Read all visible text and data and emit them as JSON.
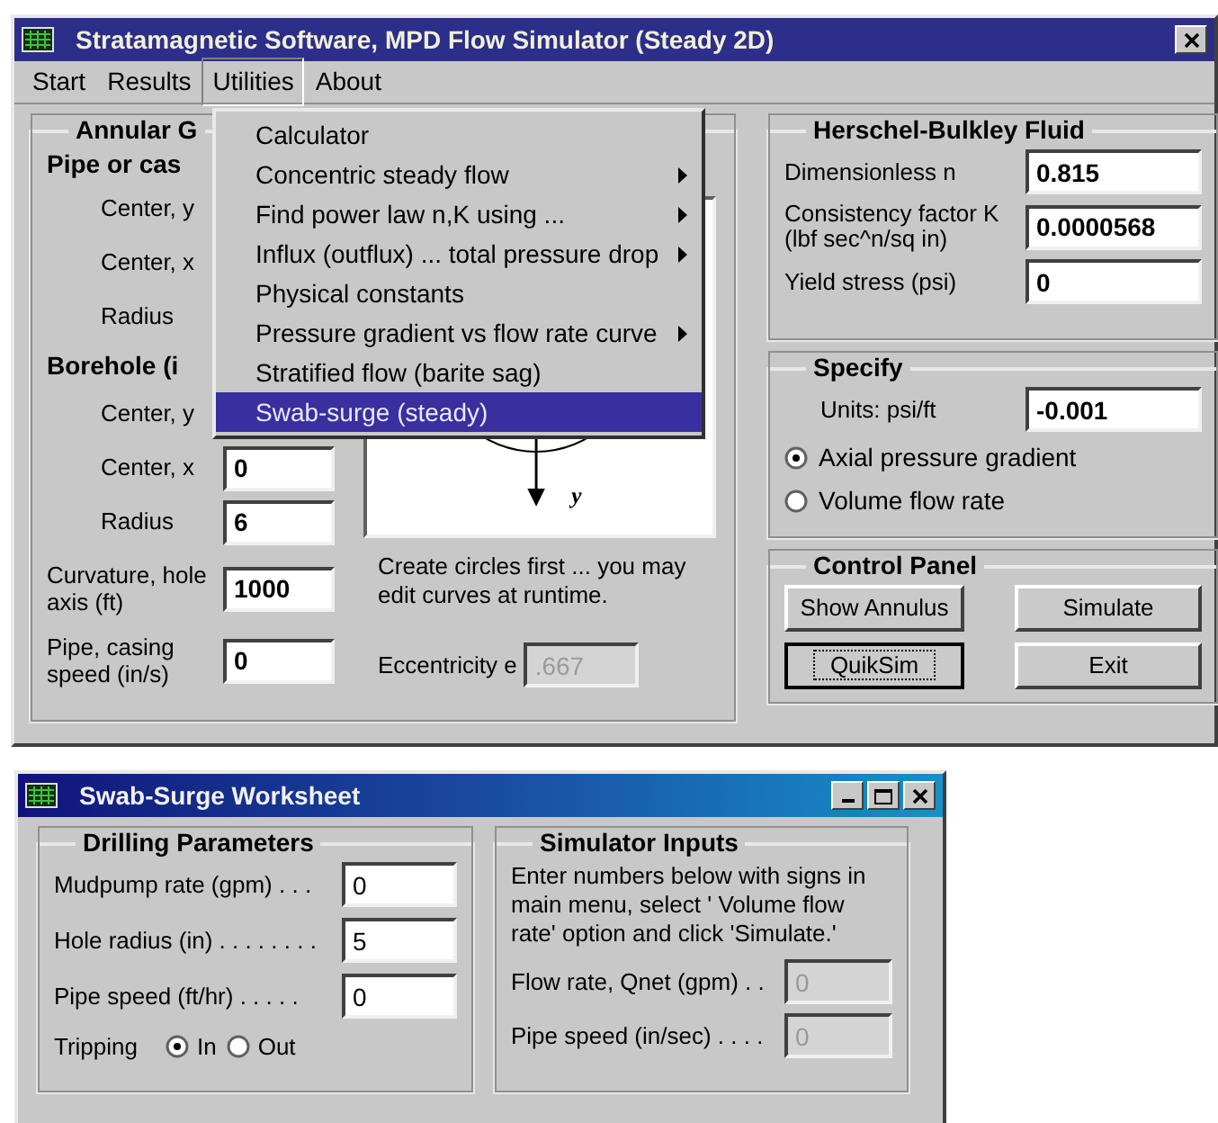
{
  "main_window": {
    "title": "Stratamagnetic Software, MPD Flow Simulator (Steady 2D)",
    "menu": [
      {
        "label": "Start",
        "selected": false
      },
      {
        "label": "Results",
        "selected": false
      },
      {
        "label": "Utilities",
        "selected": true
      },
      {
        "label": "About",
        "selected": false
      }
    ],
    "dropdown": [
      {
        "label": "Calculator",
        "submenu": false,
        "selected": false
      },
      {
        "label": "Concentric steady flow",
        "submenu": true,
        "selected": false
      },
      {
        "label": "Find power law n,K using ...",
        "submenu": true,
        "selected": false
      },
      {
        "label": "Influx (outflux) ... total pressure drop",
        "submenu": true,
        "selected": false
      },
      {
        "label": "Physical constants",
        "submenu": false,
        "selected": false
      },
      {
        "label": "Pressure gradient vs flow rate curve",
        "submenu": true,
        "selected": false
      },
      {
        "label": "Stratified flow (barite sag)",
        "submenu": false,
        "selected": false
      },
      {
        "label": "Swab-surge (steady)",
        "submenu": false,
        "selected": true
      }
    ],
    "annular_group": {
      "title": "Annular G",
      "pipe_heading": "Pipe or cas",
      "pipe_rows": [
        {
          "label": "Center, y"
        },
        {
          "label": "Center, x"
        },
        {
          "label": "Radius"
        }
      ],
      "borehole_heading": "Borehole (i",
      "borehole_rows": [
        {
          "label": "Center, y"
        },
        {
          "label": "Center, x",
          "value": "0"
        },
        {
          "label": "Radius",
          "value": "6"
        }
      ],
      "extra_rows": [
        {
          "label": "Curvature, hole axis (ft)",
          "value": "1000"
        },
        {
          "label": "Pipe, casing speed (in/s)",
          "value": "0"
        }
      ],
      "diagram": {
        "axis_label": "y"
      },
      "hint": "Create circles first ... you may edit curves at runtime.",
      "eccentricity": {
        "label": "Eccentricity e",
        "value": ".667",
        "disabled": true
      }
    },
    "fluid_group": {
      "title": "Herschel-Bulkley Fluid",
      "rows": [
        {
          "label": "Dimensionless n",
          "value": "0.815"
        },
        {
          "label": "Consistency factor K (lbf sec^n/sq in)",
          "value": "0.0000568"
        },
        {
          "label": "Yield stress (psi)",
          "value": "0"
        }
      ]
    },
    "specify_group": {
      "title": "Specify",
      "units_label": "Units: psi/ft",
      "value": "-0.001",
      "options": [
        {
          "label": "Axial pressure gradient",
          "selected": true
        },
        {
          "label": "Volume flow rate",
          "selected": false
        }
      ]
    },
    "control_panel": {
      "title": "Control Panel",
      "buttons": [
        {
          "label": "Show Annulus",
          "focused": false
        },
        {
          "label": "Simulate",
          "focused": false
        },
        {
          "label": "QuikSim",
          "focused": true
        },
        {
          "label": "Exit",
          "focused": false
        }
      ]
    }
  },
  "worksheet": {
    "title": "Swab-Surge Worksheet",
    "drilling": {
      "title": "Drilling Parameters",
      "rows": [
        {
          "label": "Mudpump rate (gpm) . . .",
          "value": "0"
        },
        {
          "label": "Hole radius (in) . . . . . . . .",
          "value": "5"
        },
        {
          "label": "Pipe speed (ft/hr) . . . . .",
          "value": "0"
        }
      ],
      "tripping_label": "Tripping",
      "tripping": [
        {
          "label": "In",
          "selected": true
        },
        {
          "label": "Out",
          "selected": false
        }
      ]
    },
    "simulator": {
      "title": "Simulator Inputs",
      "note": "Enter numbers below with signs in main menu, select ' Volume flow rate' option and click 'Simulate.'",
      "rows": [
        {
          "label": "Flow rate, Qnet (gpm) . .",
          "value": "0",
          "disabled": true
        },
        {
          "label": "Pipe speed (in/sec) . . . .",
          "value": "0",
          "disabled": true
        }
      ]
    }
  }
}
